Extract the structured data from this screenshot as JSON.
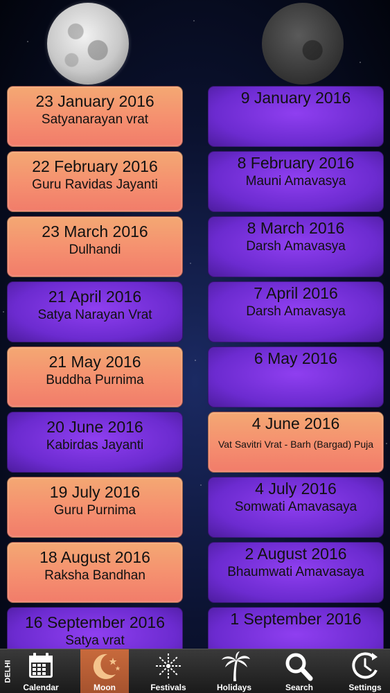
{
  "moons": {
    "full": "full-moon",
    "new": "new-moon"
  },
  "purnima": [
    {
      "date": "23 January 2016",
      "event": "Satyanarayan vrat",
      "style": "peach"
    },
    {
      "date": "22 February 2016",
      "event": "Guru Ravidas Jayanti",
      "style": "peach"
    },
    {
      "date": "23 March 2016",
      "event": "Dulhandi",
      "style": "peach"
    },
    {
      "date": "21 April 2016",
      "event": "Satya Narayan Vrat",
      "style": "violet"
    },
    {
      "date": "21 May 2016",
      "event": "Buddha Purnima",
      "style": "peach"
    },
    {
      "date": "20 June 2016",
      "event": "Kabirdas Jayanti",
      "style": "violet"
    },
    {
      "date": "19 July 2016",
      "event": "Guru Purnima",
      "style": "peach"
    },
    {
      "date": "18 August 2016",
      "event": "Raksha Bandhan",
      "style": "peach"
    },
    {
      "date": "16 September 2016",
      "event": "Satya vrat",
      "style": "violet"
    }
  ],
  "amavasya": [
    {
      "date": "9 January 2016",
      "event": "",
      "style": "violet"
    },
    {
      "date": "8 February 2016",
      "event": "Mauni Amavasya",
      "style": "violet"
    },
    {
      "date": "8 March 2016",
      "event": "Darsh Amavasya",
      "style": "violet"
    },
    {
      "date": "7 April 2016",
      "event": "Darsh Amavasya",
      "style": "violet"
    },
    {
      "date": "6 May 2016",
      "event": "",
      "style": "violet"
    },
    {
      "date": "4 June 2016",
      "event": "Vat Savitri Vrat - Barh (Bargad) Puja",
      "style": "peach"
    },
    {
      "date": "4 July 2016",
      "event": "Somwati Amavasaya",
      "style": "violet"
    },
    {
      "date": "2 August 2016",
      "event": "Bhaumwati Amavasaya",
      "style": "violet"
    },
    {
      "date": "1 September 2016",
      "event": "",
      "style": "violet"
    }
  ],
  "tabbar": {
    "city": "DELHI",
    "tabs": [
      {
        "id": "calendar",
        "label": "Calendar",
        "icon": "calendar-icon"
      },
      {
        "id": "moon",
        "label": "Moon",
        "icon": "moon-icon",
        "active": true
      },
      {
        "id": "festivals",
        "label": "Festivals",
        "icon": "fireworks-icon"
      },
      {
        "id": "holidays",
        "label": "Holidays",
        "icon": "palm-tree-icon"
      },
      {
        "id": "search",
        "label": "Search",
        "icon": "search-icon"
      },
      {
        "id": "settings",
        "label": "Settings",
        "icon": "clock-icon"
      }
    ]
  },
  "colors": {
    "peach": "#f58f6f",
    "violet": "#7a33e0",
    "tab_active": "#b85c34"
  }
}
